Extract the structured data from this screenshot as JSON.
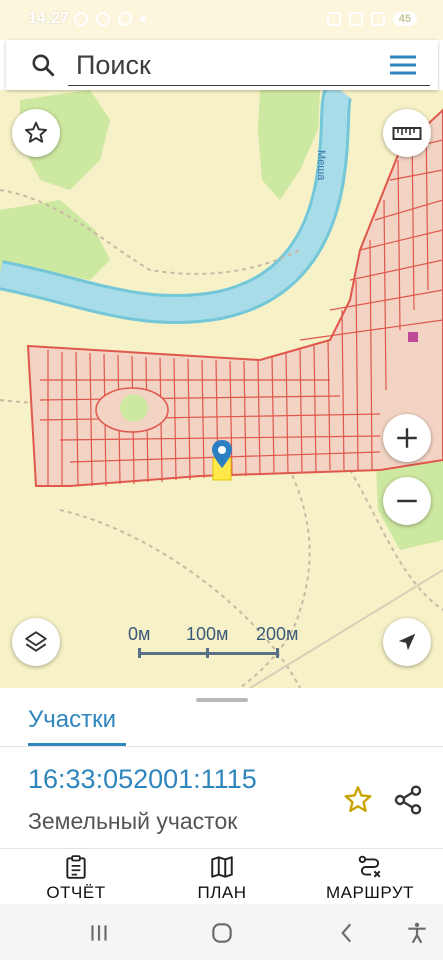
{
  "status_bar": {
    "time": "14:27",
    "battery": "45"
  },
  "search": {
    "placeholder": "Поиск"
  },
  "map": {
    "scale_labels": [
      "0м",
      "100м",
      "200м"
    ],
    "river_label": "Меша",
    "colors": {
      "land": "#f6f1c6",
      "forest": "#cde8a0",
      "river": "#a8dce8",
      "river_bank": "#74c7d8",
      "parcel_fill": "#f3d3c3",
      "parcel_border": "#e0574c",
      "selected_parcel": "#ffe94a",
      "marker": "#2c7fc1"
    },
    "buttons": [
      "favorites",
      "ruler",
      "zoom-in",
      "zoom-out",
      "layers",
      "my-location"
    ]
  },
  "sheet": {
    "tab_label": "Участки",
    "cadastral_number": "16:33:052001:1115",
    "property_type": "Земельный участок",
    "actions": [
      {
        "label": "ОТЧЁТ",
        "icon": "clipboard-icon"
      },
      {
        "label": "ПЛАН",
        "icon": "map-icon"
      },
      {
        "label": "МАРШРУТ",
        "icon": "route-icon"
      }
    ]
  },
  "accent_color": "#2f86bd"
}
